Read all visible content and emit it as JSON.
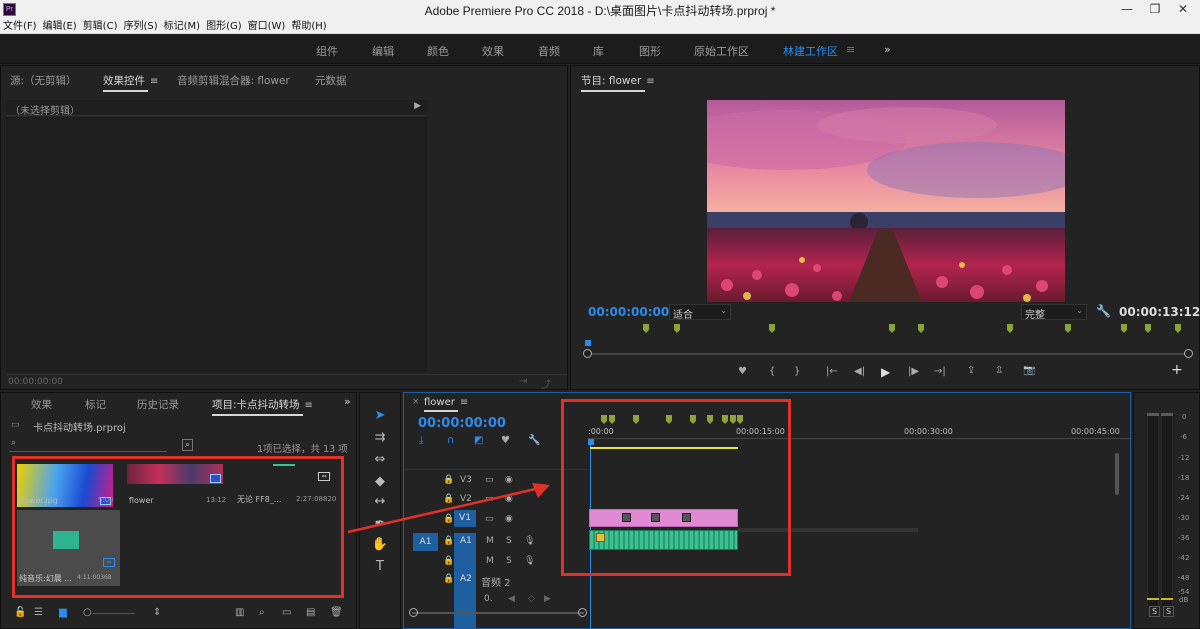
{
  "window": {
    "title": "Adobe Premiere Pro CC 2018 - D:\\桌面图片\\卡点抖动转场.prproj *",
    "app_icon": "Pr",
    "controls": [
      "minimize-icon",
      "restore-icon",
      "close-icon"
    ]
  },
  "menu": [
    "文件(F)",
    "编辑(E)",
    "剪辑(C)",
    "序列(S)",
    "标记(M)",
    "图形(G)",
    "窗口(W)",
    "帮助(H)"
  ],
  "workspaces": {
    "items": [
      "组件",
      "编辑",
      "颜色",
      "效果",
      "音频",
      "库",
      "图形",
      "原始工作区",
      "林建工作区"
    ],
    "active": "林建工作区",
    "more": "»"
  },
  "source_panel": {
    "tabs": [
      "源:（无剪辑）",
      "效果控件",
      "音频剪辑混合器: flower",
      "元数据"
    ],
    "active_tab": "效果控件",
    "no_clip": "（未选择剪辑）",
    "timecode": "00:00:00:00"
  },
  "program_monitor": {
    "title": "节目: flower",
    "timecode_in": "00:00:00:00",
    "fit": "适合",
    "quality": "完整",
    "duration": "00:00:13:12"
  },
  "project_panel": {
    "tabs": [
      "效果",
      "标记",
      "历史记录",
      "项目:卡点抖动转场"
    ],
    "active_tab": "项目:卡点抖动转场",
    "file": "卡点抖动转场.prproj",
    "search_placeholder": "",
    "selection": "1项已选择，共 13 项",
    "items": [
      {
        "name": "flower.jpg",
        "duration": "5:00"
      },
      {
        "name": "flower",
        "duration": "13:12"
      },
      {
        "name": "无论 FF8_...",
        "duration": "2:27:08820"
      },
      {
        "name": "纯音乐:幻晨 ...",
        "duration": "4:11:00368"
      }
    ]
  },
  "timeline": {
    "sequence": "flower",
    "timecode": "00:00:00:00",
    "ruler": [
      ":00:00",
      "00:00:15:00",
      "00:00:30:00",
      "00:00:45:00"
    ],
    "tracks_video": [
      "V3",
      "V2",
      "V1"
    ],
    "tracks_audio": [
      "A1",
      "A2"
    ],
    "audio2_label": "音频 2",
    "source_patch": "A1",
    "m": "M",
    "s": "S",
    "volume": "0."
  },
  "audio_meter": {
    "scale": [
      "0",
      "-6",
      "-12",
      "-18",
      "-24",
      "-30",
      "-36",
      "-42",
      "-48",
      "-54",
      "dB"
    ],
    "solo": [
      "S",
      "S"
    ]
  },
  "colors": {
    "accent": "#2d8ceb",
    "video_clip": "#e08ad6",
    "audio_clip": "#3cc192",
    "highlight": "#e0302a",
    "marker": "#8da33a"
  }
}
